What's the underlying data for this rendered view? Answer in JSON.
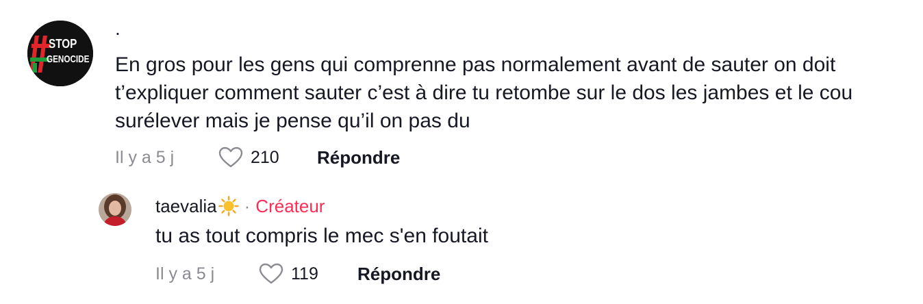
{
  "comments": [
    {
      "username": ".",
      "avatar_text": {
        "line1": "STOP",
        "line2": "GENOCIDE"
      },
      "text": "En gros pour les gens qui comprenne pas normalement avant de sauter on doit t’expliquer comment sauter c’est à dire tu retombe sur le dos les jambes et le cou surélever mais je pense qu’il on pas du",
      "time": "Il y a 5 j",
      "likes": "210",
      "reply_label": "Répondre"
    }
  ],
  "reply": {
    "username": "taevalia",
    "username_icon": "sun-emoji",
    "separator": "·",
    "badge": "Créateur",
    "text": "tu as tout compris le mec s'en foutait",
    "time": "Il y a 5 j",
    "likes": "119",
    "reply_label": "Répondre"
  },
  "colors": {
    "creator_badge": "#fe2c55",
    "meta_gray": "#8a8b91",
    "text": "#161823"
  }
}
